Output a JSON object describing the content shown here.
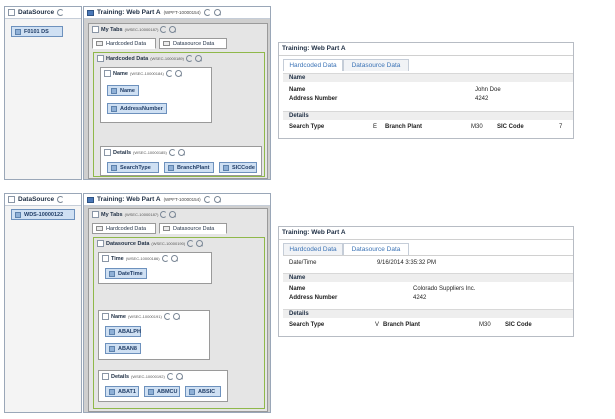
{
  "top": {
    "datasource": {
      "title": "DataSource",
      "chip": "F0101 DS"
    },
    "webpart": {
      "title": "Training: Web Part A",
      "id": "(WPFT-10000154)",
      "mytabs": {
        "title": "My Tabs",
        "id": "(WSEC-10000187)"
      },
      "tabs": [
        "Hardcoded Data",
        "Datasource Data"
      ],
      "hardcoded": {
        "title": "Hardcoded Data",
        "id": "(WSEC-10000189)"
      },
      "name_section": {
        "title": "Name",
        "id": "(WSEC-10000184)",
        "fields": [
          "Name",
          "AddressNumber"
        ]
      },
      "details_section": {
        "title": "Details",
        "id": "(WSEC-10000185)",
        "fields": [
          "SearchType",
          "BranchPlant",
          "SICCode"
        ]
      }
    },
    "rendered": {
      "title": "Training: Web Part A",
      "tabs": [
        "Hardcoded Data",
        "Datasource Data"
      ],
      "name_header": "Name",
      "rows": [
        {
          "label": "Name",
          "value": "John Doe"
        },
        {
          "label": "Address Number",
          "value": "4242"
        }
      ],
      "details_header": "Details",
      "details": {
        "search_type_label": "Search Type",
        "search_type_value": "E",
        "branch_plant_label": "Branch Plant",
        "branch_plant_value": "M30",
        "sic_label": "SIC Code",
        "sic_value": "7"
      }
    }
  },
  "bottom": {
    "datasource": {
      "title": "DataSource",
      "chip": "WDS-10000122"
    },
    "webpart": {
      "title": "Training: Web Part A",
      "id": "(WPFT-10000154)",
      "mytabs": {
        "title": "My Tabs",
        "id": "(WSEC-10000187)"
      },
      "tabs": [
        "Hardcoded Data",
        "Datasource Data"
      ],
      "dsdata": {
        "title": "Datasource Data",
        "id": "(WSEC-10000190)"
      },
      "time_section": {
        "title": "Time",
        "id": "(WSEC-10000186)",
        "fields": [
          "DateTime"
        ]
      },
      "name_section": {
        "title": "Name",
        "id": "(WSEC-10000191)",
        "fields": [
          "ABALPH",
          "ABAN8"
        ]
      },
      "details_section": {
        "title": "Details",
        "id": "(WSEC-10000192)",
        "fields": [
          "ABAT1",
          "ABMCU",
          "ABSIC"
        ]
      }
    },
    "rendered": {
      "title": "Training: Web Part A",
      "tabs": [
        "Hardcoded Data",
        "Datasource Data"
      ],
      "datetime_label": "Date/Time",
      "datetime_value": "9/16/2014 3:35:32 PM",
      "name_header": "Name",
      "rows": [
        {
          "label": "Name",
          "value": "Colorado Suppliers Inc."
        },
        {
          "label": "Address Number",
          "value": "4242"
        }
      ],
      "details_header": "Details",
      "details": {
        "search_type_label": "Search Type",
        "search_type_value": "V",
        "branch_plant_label": "Branch Plant",
        "branch_plant_value": "M30",
        "sic_label": "SIC Code",
        "sic_value": ""
      }
    }
  },
  "colors": {
    "accent_blue": "#3b73b6",
    "field_fill": "#cfe0f3",
    "green_frame": "#8fb84a"
  }
}
